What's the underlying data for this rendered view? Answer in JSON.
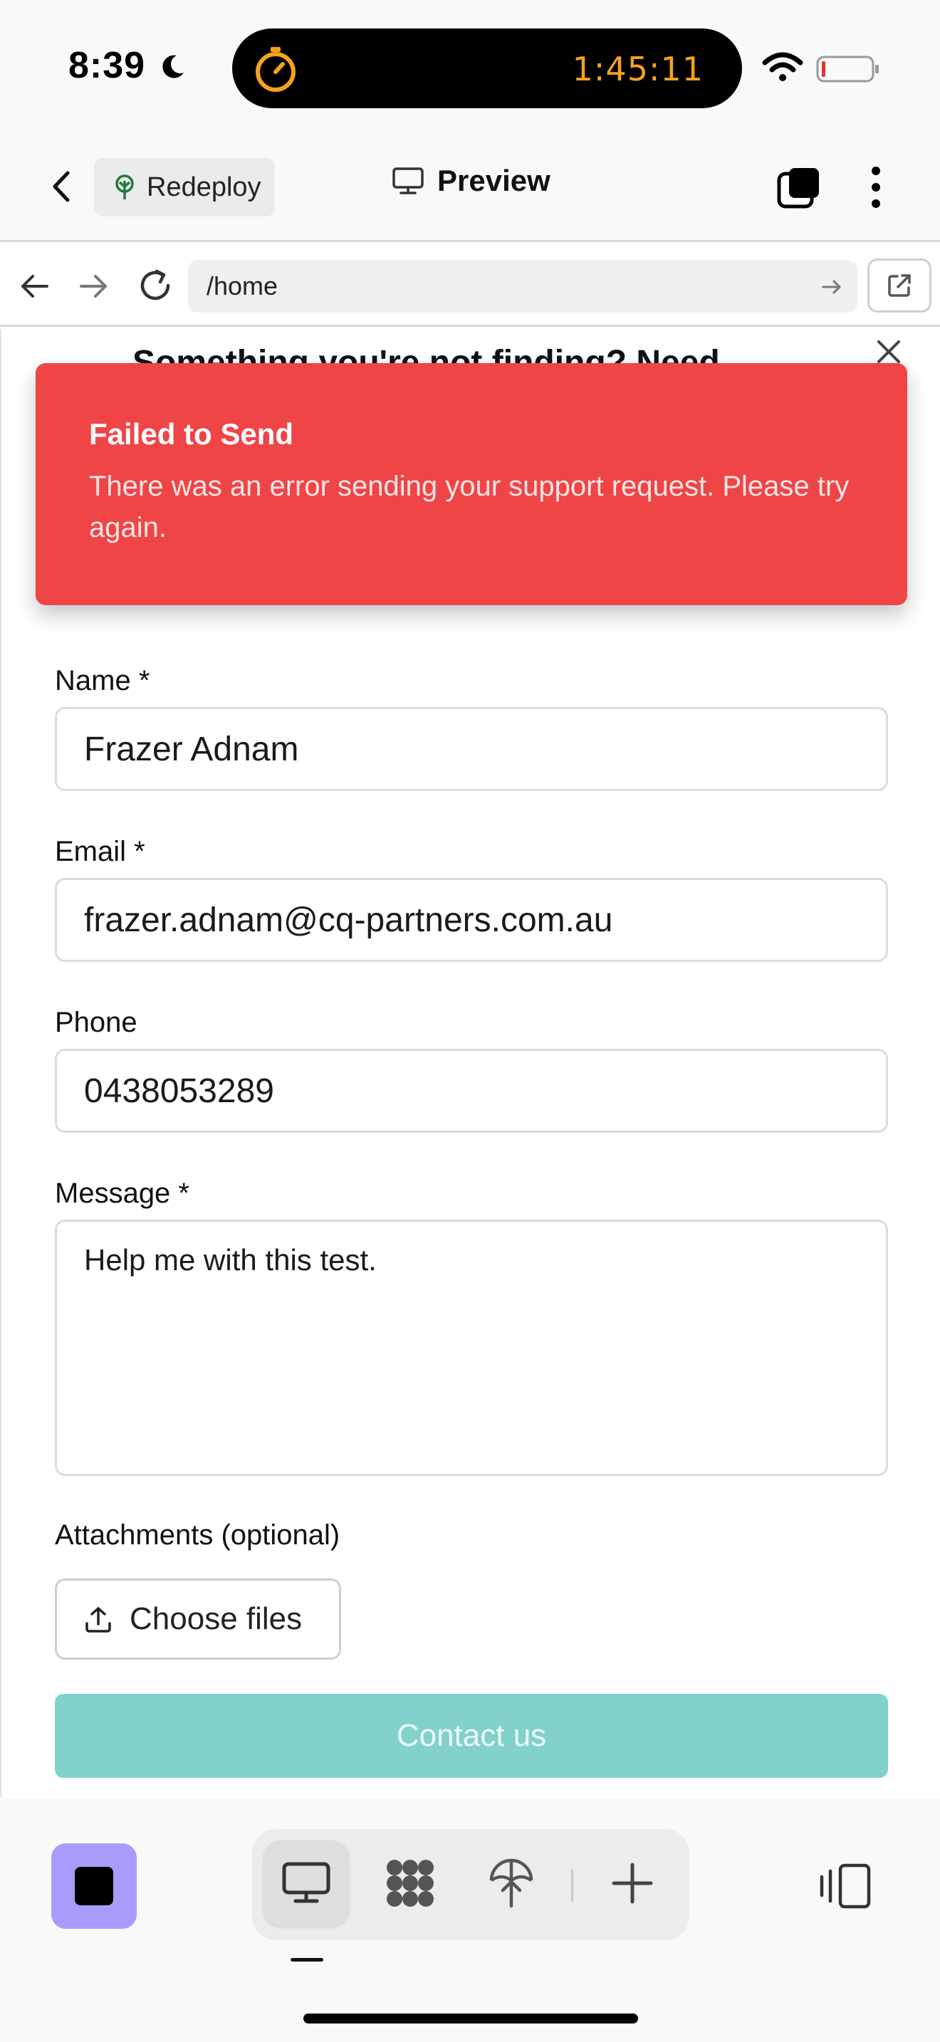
{
  "status_bar": {
    "time": "8:39",
    "live_activity_timer": "1:45:11",
    "timer_color": "#f4a21c"
  },
  "header": {
    "deploy_label": "Redeploy",
    "title": "Preview"
  },
  "browser": {
    "url": "/home"
  },
  "page": {
    "heading_partial": "Something you're not finding? Need",
    "toast": {
      "title": "Failed to Send",
      "message": "There was an error sending your support request. Please try again.",
      "color": "#ef4547"
    },
    "form": {
      "name_label": "Name *",
      "name_value": "Frazer Adnam",
      "email_label": "Email *",
      "email_value": "frazer.adnam@cq-partners.com.au",
      "phone_label": "Phone",
      "phone_value": "0438053289",
      "message_label": "Message *",
      "message_value": "Help me with this test.",
      "attachments_label": "Attachments (optional)",
      "choose_files_label": "Choose files",
      "submit_label": "Contact us",
      "submit_color": "#82d1cb"
    }
  },
  "bottom_bar": {
    "app_tile_color": "#a89cfb",
    "items": [
      "monitor-icon",
      "grid-icon",
      "deploy-icon",
      "plus-icon"
    ],
    "active_item": "monitor-icon"
  }
}
